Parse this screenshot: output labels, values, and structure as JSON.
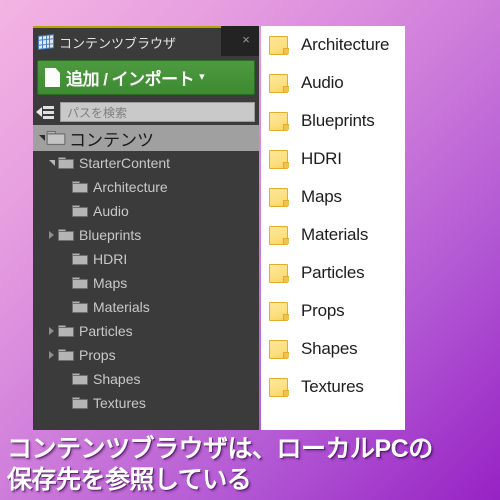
{
  "window": {
    "tab": {
      "label": "コンテンツブラウザ",
      "close_label": "×",
      "icon": "content-browser-icon",
      "accent_color": "#b8a400"
    },
    "toolbar": {
      "add_import_label": "追加 / インポート",
      "add_import_caret": "▾",
      "add_import_icon": "new-document-icon",
      "add_import_color": "#4d9a3f"
    },
    "search": {
      "filter_icon": "filter-icon",
      "placeholder": "パスを検索",
      "value": ""
    },
    "tree": {
      "root": {
        "label": "コンテンツ",
        "icon": "folder-open-icon",
        "twisty": "expanded",
        "selected": true
      },
      "items": [
        {
          "label": "StarterContent",
          "twisty": "expanded",
          "depth": 1
        },
        {
          "label": "Architecture",
          "twisty": "none",
          "depth": 2
        },
        {
          "label": "Audio",
          "twisty": "none",
          "depth": 2
        },
        {
          "label": "Blueprints",
          "twisty": "collapsed",
          "depth": 2
        },
        {
          "label": "HDRI",
          "twisty": "none",
          "depth": 2
        },
        {
          "label": "Maps",
          "twisty": "none",
          "depth": 2
        },
        {
          "label": "Materials",
          "twisty": "none",
          "depth": 2
        },
        {
          "label": "Particles",
          "twisty": "collapsed",
          "depth": 2
        },
        {
          "label": "Props",
          "twisty": "collapsed",
          "depth": 2
        },
        {
          "label": "Shapes",
          "twisty": "none",
          "depth": 2
        },
        {
          "label": "Textures",
          "twisty": "none",
          "depth": 2
        }
      ]
    }
  },
  "explorer": {
    "folder_icon": "folder-icon",
    "items": [
      {
        "label": "Architecture"
      },
      {
        "label": "Audio"
      },
      {
        "label": "Blueprints"
      },
      {
        "label": "HDRI"
      },
      {
        "label": "Maps"
      },
      {
        "label": "Materials"
      },
      {
        "label": "Particles"
      },
      {
        "label": "Props"
      },
      {
        "label": "Shapes"
      },
      {
        "label": "Textures"
      }
    ]
  },
  "caption": {
    "line1": "コンテンツブラウザは、ローカルPCの",
    "line2": "保存先を参照している",
    "text_color": "#ffffff"
  },
  "background": {
    "start_color": "#f3b4e2",
    "end_color": "#9722c4"
  }
}
